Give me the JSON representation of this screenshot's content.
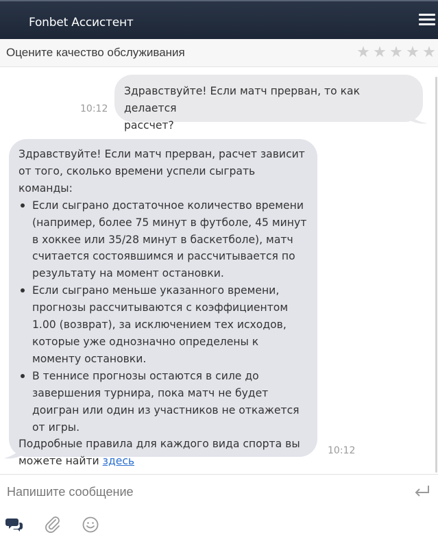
{
  "header": {
    "title": "Fonbet Ассистент",
    "menu_icon": "hamburger-menu-icon"
  },
  "rating": {
    "label": "Оцените качество обслуживания",
    "stars": [
      "★",
      "★",
      "★",
      "★",
      "★"
    ],
    "star_color": "#cfcfcf"
  },
  "messages": {
    "user": {
      "lines": [
        "Здравствуйте! Если матч прерван, то как делается",
        "рассчет?"
      ],
      "time": "10:12"
    },
    "bot": {
      "intro": [
        "Здравствуйте! Если матч прерван, расчет зависит",
        "от того, сколько времени успели сыграть команды:"
      ],
      "bullets": [
        [
          "Если сыграно достаточное количество времени",
          "(например, более 75 минут в футболе, 45 минут",
          "в хоккее или 35/28 минут в баскетболе), матч",
          "считается состоявшимся и рассчитывается по",
          "результату на момент остановки."
        ],
        [
          "Если сыграно меньше указанного времени,",
          "прогнозы рассчитываются с коэффициентом",
          "1.00 (возврат), за исключением тех исходов,",
          "которые уже однозначно определены к",
          "моменту остановки."
        ],
        [
          "В теннисе прогнозы остаются в силе до",
          "завершения турнира, пока матч не будет",
          "доигран или один из участников не откажется",
          "от игры."
        ]
      ],
      "outro": [
        "Подробные правила для каждого вида спорта вы",
        "можете найти "
      ],
      "link_label": "здесь",
      "time": "10:12"
    }
  },
  "composer": {
    "placeholder": "Напишите сообщение",
    "value": "",
    "icons": [
      "send-icon",
      "chat-bubbles-icon",
      "paperclip-icon",
      "smiley-icon"
    ]
  },
  "colors": {
    "header_bg": "#1c2636",
    "user_bubble": "#e9e9ec",
    "bot_bubble": "#e3e4ea",
    "link": "#2a6fd0"
  }
}
